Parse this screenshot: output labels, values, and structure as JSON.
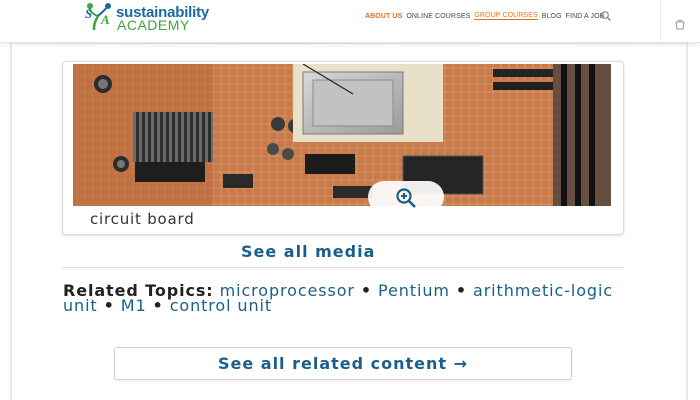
{
  "header": {
    "logo": {
      "line1": "sustainability",
      "line2": "ACADEMY",
      "mark_glyph": "SA"
    },
    "nav": [
      {
        "label": "ABOUT US",
        "style": "accent"
      },
      {
        "label": "ONLINE COURSES",
        "style": "normal"
      },
      {
        "label": "GROUP COURSES",
        "style": "accent-underline"
      },
      {
        "label": "BLOG",
        "style": "normal"
      },
      {
        "label": "FIND A JOB",
        "style": "normal"
      }
    ],
    "search_icon": "search-icon",
    "cart_icon": "cart-icon",
    "colors": {
      "logo_blue": "#1a6aa0",
      "logo_green": "#3aa83a",
      "nav_accent": "#e8701a"
    }
  },
  "media": {
    "image_subject": "circuit board",
    "caption": "circuit board",
    "zoom_icon": "magnify-plus-icon",
    "see_all_label": "See all media"
  },
  "related": {
    "lead": "Related Topics:",
    "topics": [
      "microprocessor",
      "Pentium",
      "arithmetic-logic unit",
      "M1",
      "control unit"
    ],
    "separator": "•",
    "see_all_label": "See all related content →"
  },
  "colors": {
    "link": "#1a5f8a",
    "text": "#222222"
  }
}
